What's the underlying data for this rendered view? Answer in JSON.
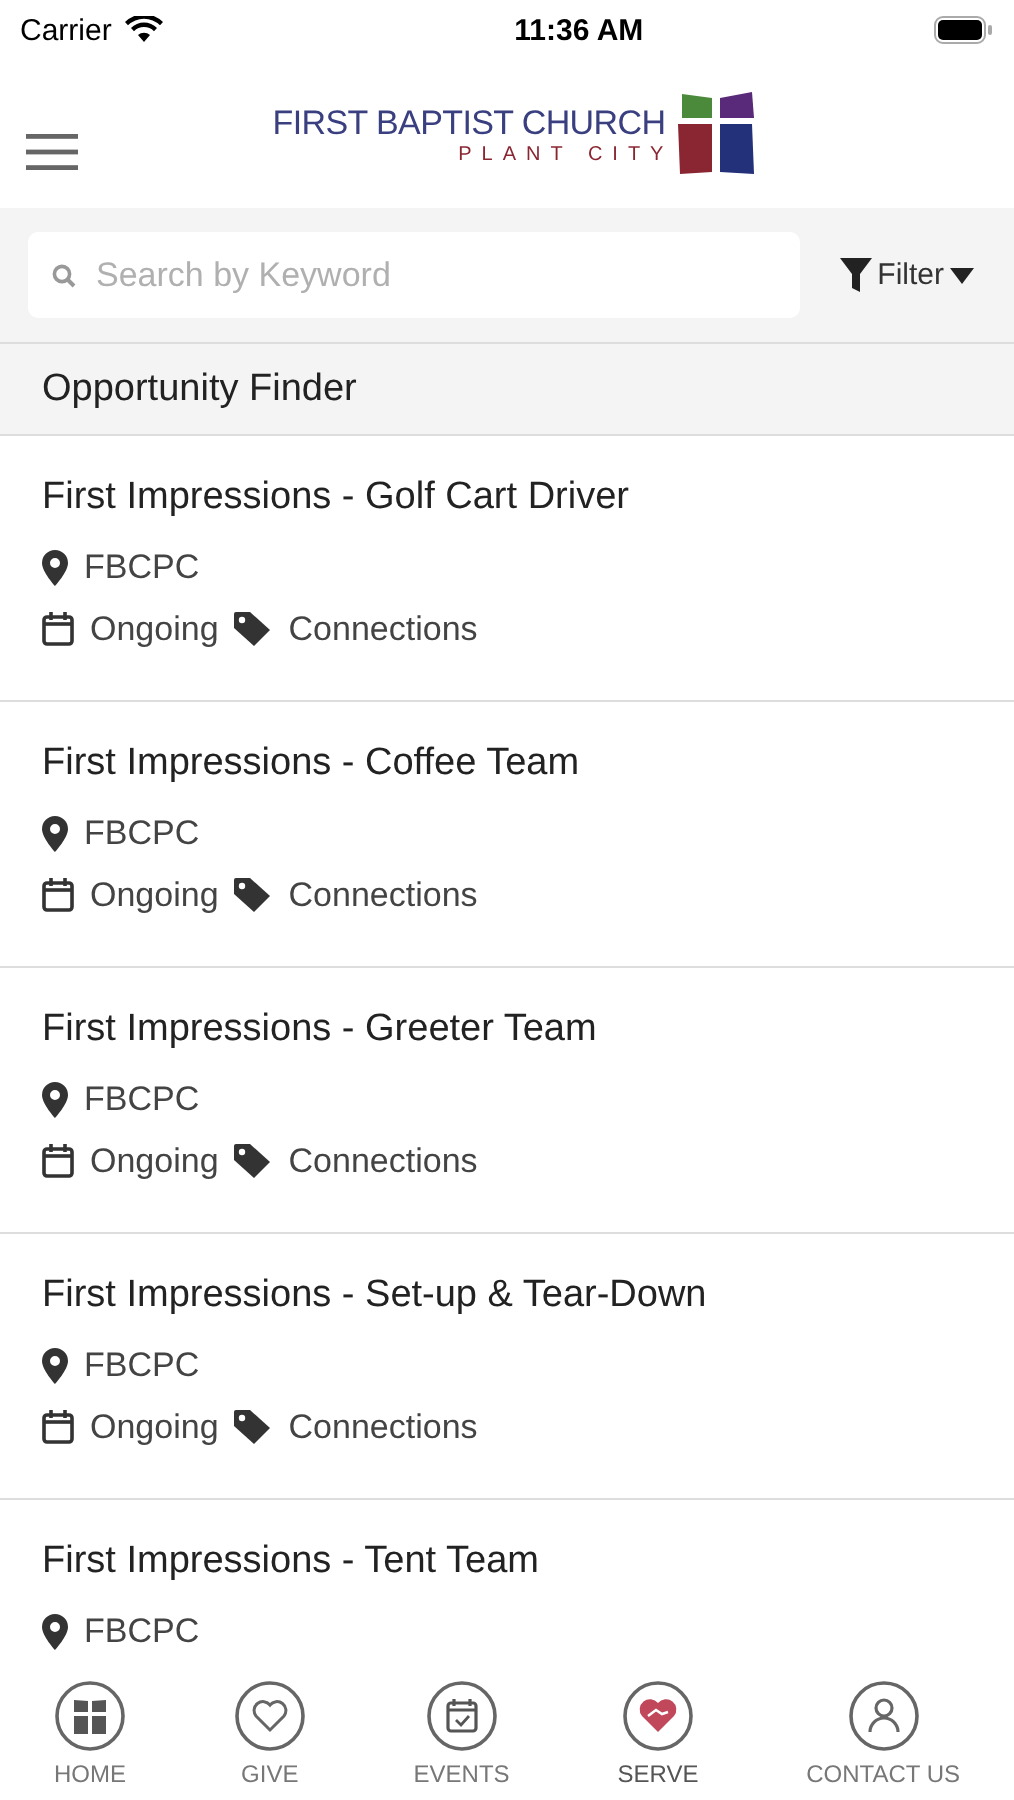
{
  "status_bar": {
    "carrier": "Carrier",
    "time": "11:36 AM"
  },
  "header": {
    "logo_title": "FIRST BAPTIST CHURCH",
    "logo_subtitle": "PLANT CITY"
  },
  "search": {
    "placeholder": "Search by Keyword"
  },
  "filter": {
    "label": "Filter"
  },
  "section_title": "Opportunity Finder",
  "opportunities": [
    {
      "title": "First Impressions - Golf Cart Driver",
      "location": "FBCPC",
      "schedule": "Ongoing",
      "category": "Connections"
    },
    {
      "title": "First Impressions - Coffee Team",
      "location": "FBCPC",
      "schedule": "Ongoing",
      "category": "Connections"
    },
    {
      "title": "First Impressions - Greeter Team",
      "location": "FBCPC",
      "schedule": "Ongoing",
      "category": "Connections"
    },
    {
      "title": "First Impressions - Set-up & Tear-Down",
      "location": "FBCPC",
      "schedule": "Ongoing",
      "category": "Connections"
    },
    {
      "title": "First Impressions - Tent Team",
      "location": "FBCPC"
    }
  ],
  "tabs": [
    {
      "label": "HOME",
      "kind": "home",
      "selected": false
    },
    {
      "label": "GIVE",
      "kind": "give",
      "selected": false
    },
    {
      "label": "EVENTS",
      "kind": "events",
      "selected": false
    },
    {
      "label": "SERVE",
      "kind": "serve",
      "selected": true
    },
    {
      "label": "CONTACT US",
      "kind": "contact",
      "selected": false
    }
  ]
}
